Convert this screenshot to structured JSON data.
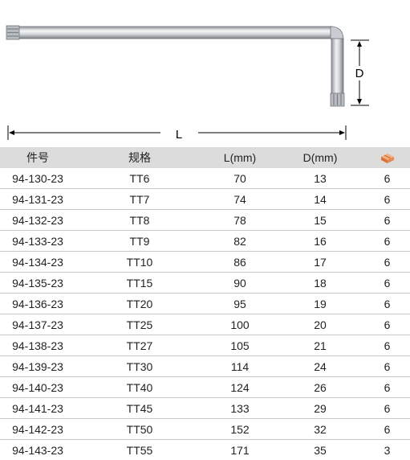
{
  "diagram": {
    "dimension_length_label": "L",
    "dimension_height_label": "D"
  },
  "table": {
    "headers": {
      "part_no": "件号",
      "spec": "规格",
      "length": "L(mm)",
      "d": "D(mm)",
      "pack_icon": "box-icon"
    },
    "rows": [
      {
        "part_no": "94-130-23",
        "spec": "TT6",
        "length": "70",
        "d": "13",
        "pack": "6"
      },
      {
        "part_no": "94-131-23",
        "spec": "TT7",
        "length": "74",
        "d": "14",
        "pack": "6"
      },
      {
        "part_no": "94-132-23",
        "spec": "TT8",
        "length": "78",
        "d": "15",
        "pack": "6"
      },
      {
        "part_no": "94-133-23",
        "spec": "TT9",
        "length": "82",
        "d": "16",
        "pack": "6"
      },
      {
        "part_no": "94-134-23",
        "spec": "TT10",
        "length": "86",
        "d": "17",
        "pack": "6"
      },
      {
        "part_no": "94-135-23",
        "spec": "TT15",
        "length": "90",
        "d": "18",
        "pack": "6"
      },
      {
        "part_no": "94-136-23",
        "spec": "TT20",
        "length": "95",
        "d": "19",
        "pack": "6"
      },
      {
        "part_no": "94-137-23",
        "spec": "TT25",
        "length": "100",
        "d": "20",
        "pack": "6"
      },
      {
        "part_no": "94-138-23",
        "spec": "TT27",
        "length": "105",
        "d": "21",
        "pack": "6"
      },
      {
        "part_no": "94-139-23",
        "spec": "TT30",
        "length": "114",
        "d": "24",
        "pack": "6"
      },
      {
        "part_no": "94-140-23",
        "spec": "TT40",
        "length": "124",
        "d": "26",
        "pack": "6"
      },
      {
        "part_no": "94-141-23",
        "spec": "TT45",
        "length": "133",
        "d": "29",
        "pack": "6"
      },
      {
        "part_no": "94-142-23",
        "spec": "TT50",
        "length": "152",
        "d": "32",
        "pack": "6"
      },
      {
        "part_no": "94-143-23",
        "spec": "TT55",
        "length": "171",
        "d": "35",
        "pack": "3"
      }
    ]
  }
}
